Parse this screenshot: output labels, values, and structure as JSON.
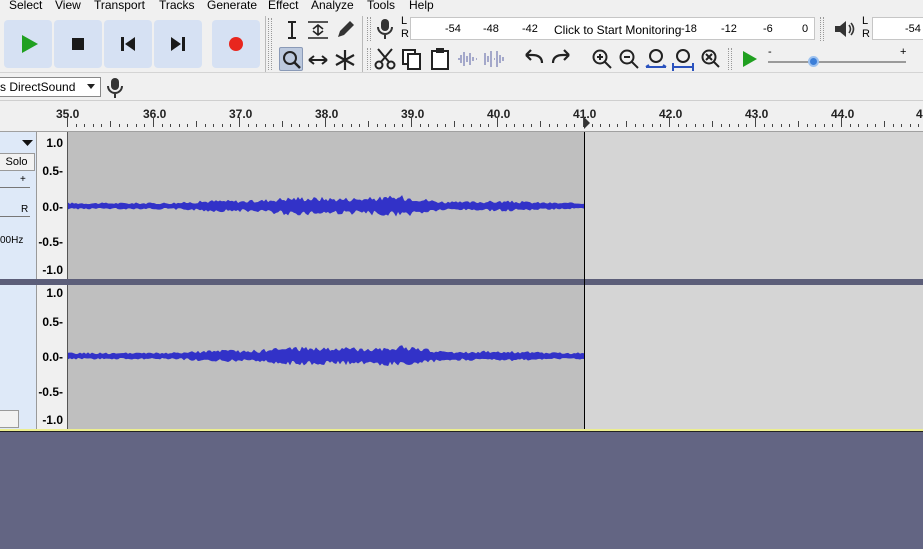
{
  "menu": {
    "items": [
      "Select",
      "View",
      "Transport",
      "Tracks",
      "Generate",
      "Effect",
      "Analyze",
      "Tools",
      "Help"
    ]
  },
  "meters": {
    "record_lr": [
      "L",
      "R"
    ],
    "record_scale": [
      "-54",
      "-48",
      "-42",
      "-18",
      "-12",
      "-6",
      "0"
    ],
    "record_monitor_text": "Click to Start Monitoring",
    "playback_lr": [
      "L",
      "R"
    ],
    "playback_scale": [
      "-54"
    ]
  },
  "device": {
    "host": "s DirectSound"
  },
  "playback_speed": {
    "minus": "-",
    "plus": "+",
    "level": 0.5
  },
  "timeline": {
    "labels": [
      "35.0",
      "36.0",
      "37.0",
      "38.0",
      "39.0",
      "40.0",
      "41.0",
      "42.0",
      "43.0",
      "44.0",
      "4"
    ]
  },
  "track_panel": {
    "solo_label": "Solo",
    "pan_plus": "+",
    "pan_r": "R",
    "rate_label": "00Hz"
  },
  "amplitude_labels": [
    "1.0",
    "0.5-",
    "0.0-",
    "-0.5-",
    "-1.0"
  ],
  "colors": {
    "waveform": "#3232c8",
    "selection": "#bfbfbf",
    "background": "#d5d5d5",
    "record": "#e8261e",
    "play": "#20a020"
  }
}
